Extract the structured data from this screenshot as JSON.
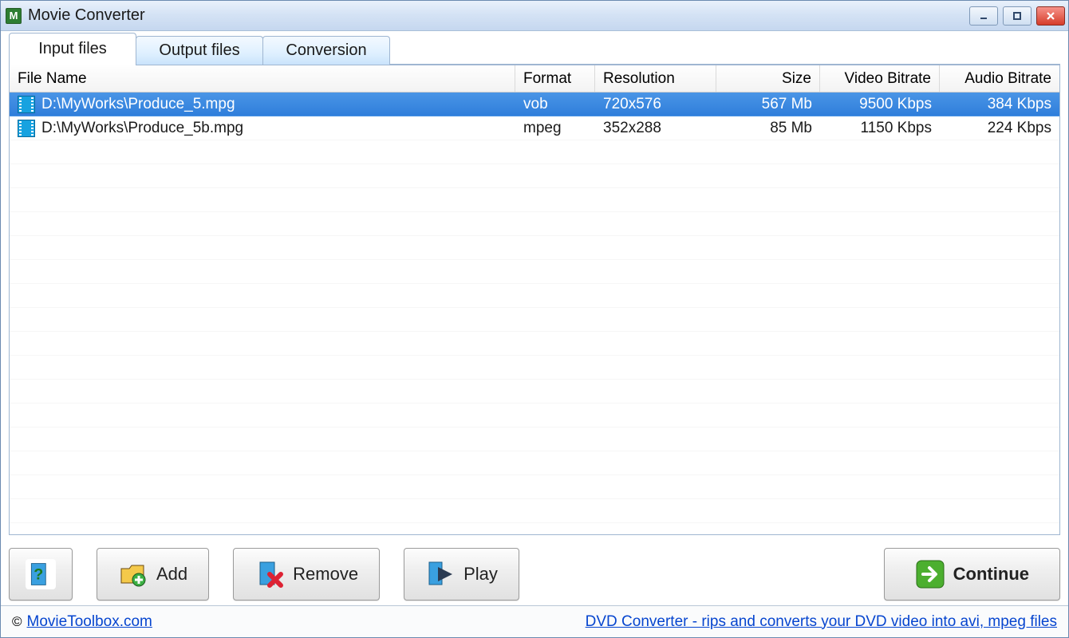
{
  "window": {
    "title": "Movie Converter"
  },
  "tabs": [
    {
      "label": "Input files",
      "active": true
    },
    {
      "label": "Output files",
      "active": false
    },
    {
      "label": "Conversion",
      "active": false
    }
  ],
  "columns": {
    "filename": "File Name",
    "format": "Format",
    "resolution": "Resolution",
    "size": "Size",
    "vbitrate": "Video Bitrate",
    "abitrate": "Audio Bitrate"
  },
  "rows": [
    {
      "filename": "D:\\MyWorks\\Produce_5.mpg",
      "format": "vob",
      "resolution": "720x576",
      "size": "567 Mb",
      "vbitrate": "9500 Kbps",
      "abitrate": "384 Kbps",
      "selected": true
    },
    {
      "filename": "D:\\MyWorks\\Produce_5b.mpg",
      "format": "mpeg",
      "resolution": "352x288",
      "size": "85 Mb",
      "vbitrate": "1150 Kbps",
      "abitrate": "224 Kbps",
      "selected": false
    }
  ],
  "buttons": {
    "add": "Add",
    "remove": "Remove",
    "play": "Play",
    "continue": "Continue"
  },
  "footer": {
    "site": "MovieToolbox.com",
    "promo": "DVD Converter - rips and converts your DVD video into avi, mpeg files"
  }
}
